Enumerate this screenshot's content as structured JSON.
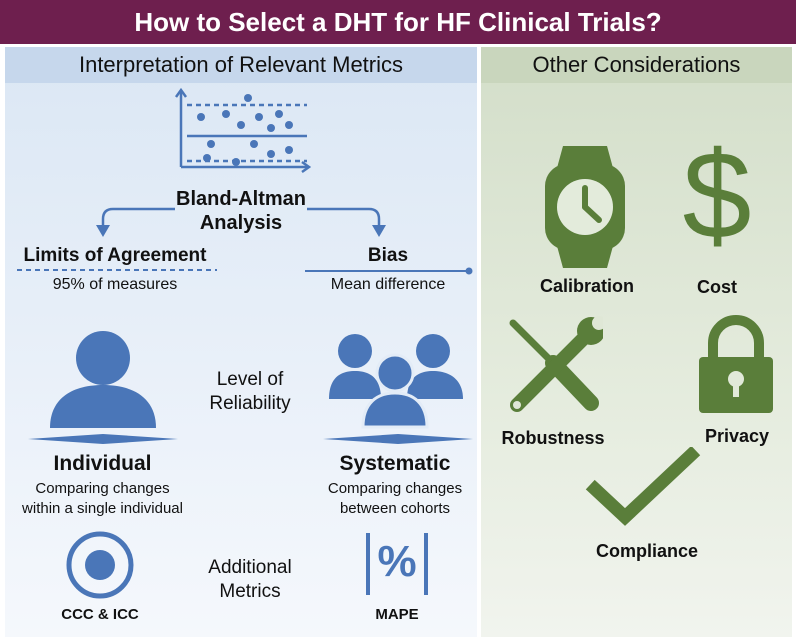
{
  "title": "How to Select a DHT for HF Clinical Trials?",
  "left_header": "Interpretation of Relevant Metrics",
  "right_header": "Other Considerations",
  "bland_altman": {
    "line1": "Bland-Altman",
    "line2": "Analysis"
  },
  "limits": {
    "title": "Limits of Agreement",
    "subtitle": "95% of measures"
  },
  "bias": {
    "title": "Bias",
    "subtitle": "Mean difference"
  },
  "reliability": {
    "line1": "Level of",
    "line2": "Reliability"
  },
  "individual": {
    "title": "Individual",
    "line1": "Comparing changes",
    "line2": "within a single individual"
  },
  "systematic": {
    "title": "Systematic",
    "line1": "Comparing changes",
    "line2": "between cohorts"
  },
  "additional": {
    "line1": "Additional",
    "line2": "Metrics"
  },
  "ccc_label": "CCC & ICC",
  "mape_label": "MAPE",
  "mape_symbol": "%",
  "considerations": {
    "calibration": "Calibration",
    "cost": "Cost",
    "robustness": "Robustness",
    "privacy": "Privacy",
    "compliance": "Compliance"
  },
  "colors": {
    "title_bg": "#6e1f4e",
    "blue": "#4a76b8",
    "green": "#5a7e3a"
  }
}
